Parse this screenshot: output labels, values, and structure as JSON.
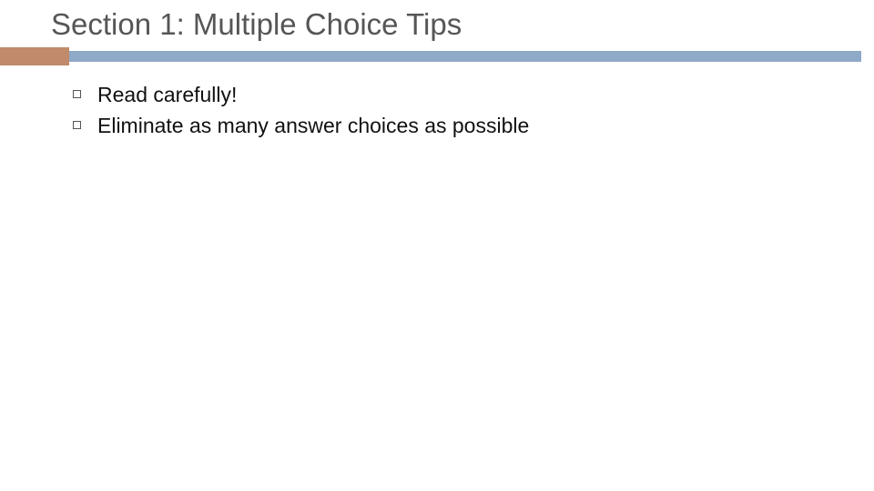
{
  "slide": {
    "title": "Section 1: Multiple Choice Tips",
    "bullets": [
      "Read carefully!",
      "Eliminate as many answer choices as possible"
    ]
  }
}
